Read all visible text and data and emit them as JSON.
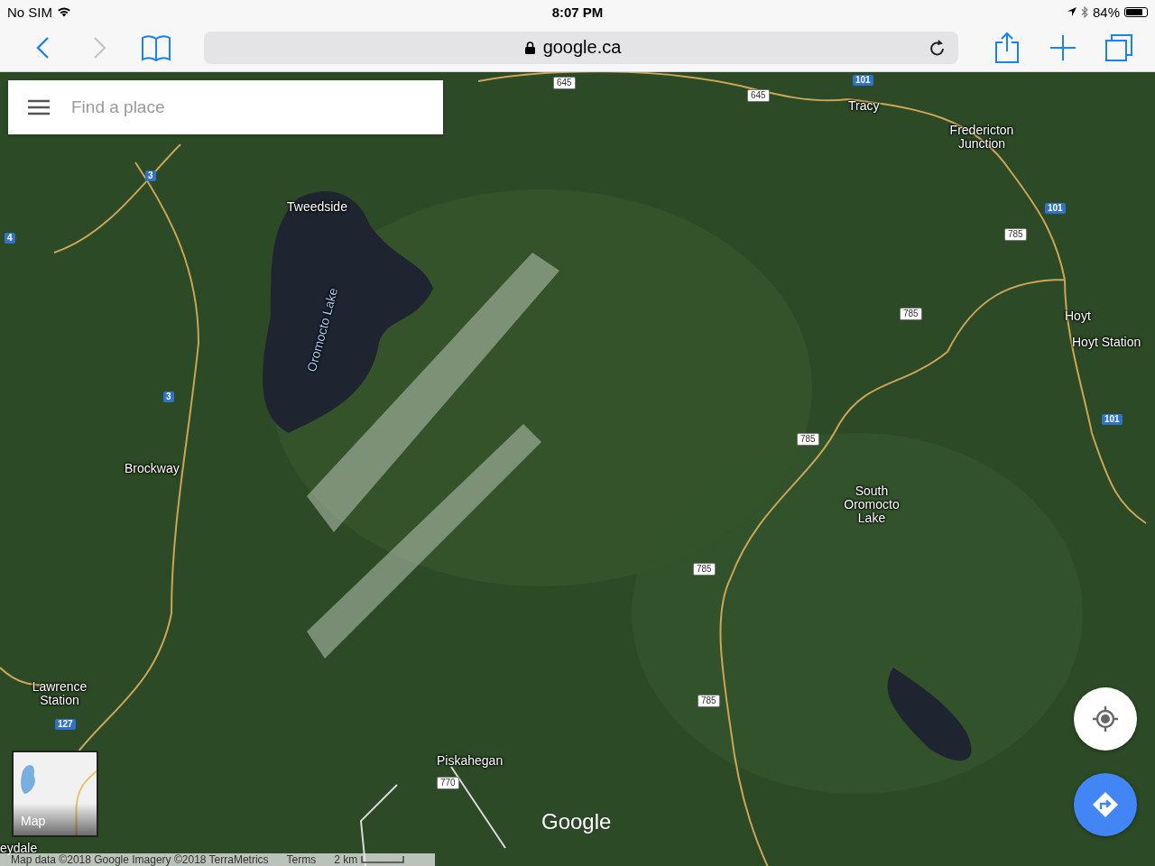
{
  "status_bar": {
    "carrier": "No SIM",
    "time": "8:07 PM",
    "battery": "84%"
  },
  "toolbar": {
    "back_enabled": true,
    "forward_enabled": false,
    "url": "google.ca",
    "secure": true
  },
  "search": {
    "placeholder": "Find a place"
  },
  "map": {
    "labels": [
      {
        "text": "Tweedside"
      },
      {
        "text": "Oromocto Lake",
        "kind": "water"
      },
      {
        "text": "Tracy"
      },
      {
        "text": "Fredericton Junction"
      },
      {
        "text": "Hoyt"
      },
      {
        "text": "Hoyt Station"
      },
      {
        "text": "Brockway"
      },
      {
        "text": "South Oromocto Lake"
      },
      {
        "text": "Lawrence Station"
      },
      {
        "text": "Piskahegan"
      },
      {
        "text": "eydale"
      }
    ],
    "shields": [
      {
        "text": "645",
        "kind": "local"
      },
      {
        "text": "645",
        "kind": "local"
      },
      {
        "text": "101",
        "kind": "highway"
      },
      {
        "text": "101",
        "kind": "highway"
      },
      {
        "text": "785",
        "kind": "local"
      },
      {
        "text": "785",
        "kind": "local"
      },
      {
        "text": "785",
        "kind": "local"
      },
      {
        "text": "785",
        "kind": "local"
      },
      {
        "text": "785",
        "kind": "local"
      },
      {
        "text": "101",
        "kind": "highway"
      },
      {
        "text": "3",
        "kind": "highway"
      },
      {
        "text": "3",
        "kind": "highway"
      },
      {
        "text": "4",
        "kind": "highway"
      },
      {
        "text": "127",
        "kind": "highway"
      },
      {
        "text": "770",
        "kind": "local"
      }
    ],
    "layer_toggle": "Map",
    "logo": "Google",
    "attribution": "Map data ©2018 Google Imagery ©2018 TerraMetrics",
    "terms": "Terms",
    "scale": "2 km"
  }
}
